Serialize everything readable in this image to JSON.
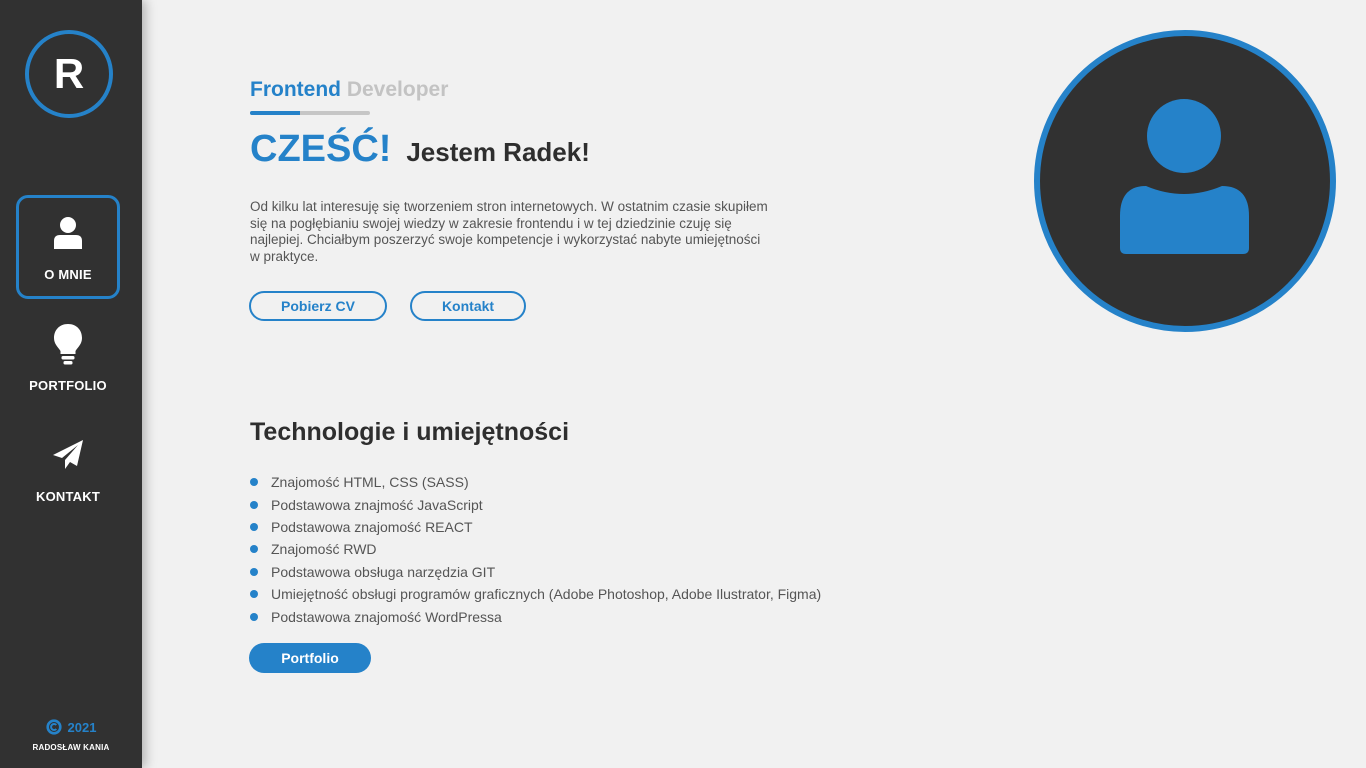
{
  "sidebar": {
    "logo_letter": "R",
    "items": [
      {
        "label": "O MNIE",
        "icon": "user-icon",
        "active": true
      },
      {
        "label": "PORTFOLIO",
        "icon": "lightbulb-icon",
        "active": false
      },
      {
        "label": "KONTAKT",
        "icon": "paper-plane-icon",
        "active": false
      }
    ],
    "footer": {
      "year": "2021",
      "name": "RADOSŁAW KANIA",
      "icon": "copyright-icon"
    }
  },
  "hero": {
    "subtitle_part1": "Frontend",
    "subtitle_part2": "Developer",
    "subtitle_progress": 0.42,
    "greeting": "CZEŚĆ!",
    "name_line": "Jestem Radek!",
    "intro": "Od kilku lat interesuję się tworzeniem stron internetowych. W ostatnim czasie skupiłem się na pogłębianiu swojej wiedzy w zakresie frontendu i w tej dziedzinie czuję się najlepiej. Chciałbym poszerzyć swoje kompetencje i wykorzystać nabyte umiejętności w praktyce.",
    "cv_button": "Pobierz CV",
    "contact_button": "Kontakt",
    "avatar_icon": "user-avatar-icon"
  },
  "skills": {
    "title": "Technologie i umiejętności",
    "items": [
      "Znajomość HTML, CSS (SASS)",
      "Podstawowa znajmość JavaScript",
      "Podstawowa znajomość REACT",
      "Znajomość RWD",
      "Podstawowa obsługa narzędzia GIT",
      "Umiejętność obsługi programów graficznych (Adobe Photoshop, Adobe Ilustrator, Figma)",
      "Podstawowa znajomość WordPressa"
    ],
    "portfolio_button": "Portfolio"
  },
  "colors": {
    "accent": "#2582c9",
    "sidebar_bg": "#313131",
    "page_bg": "#f1f1f1"
  }
}
